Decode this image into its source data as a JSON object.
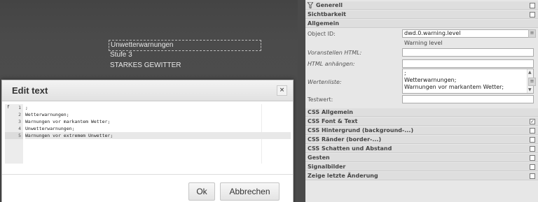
{
  "canvas": {
    "widgets": [
      "Unwetterwarnungen",
      "Stufe 3",
      "STARKES GEWITTER"
    ]
  },
  "dialog": {
    "title": "Edit text",
    "close": "×",
    "fold_marker": "f",
    "lines": [
      ";",
      "Wetterwarnungen;",
      "Warnungen vor markantem Wetter;",
      "Unwetterwarnungen;",
      "Warnungen vor extremem Unwetter;"
    ],
    "line_numbers": [
      "1",
      "2",
      "3",
      "4",
      "5"
    ],
    "active_line": 5,
    "ok_label": "Ok",
    "cancel_label": "Abbrechen"
  },
  "inspector": {
    "generell": "Generell",
    "sichtbarkeit": "Sichtbarkeit",
    "allgemein": "Allgemein",
    "object_id_label": "Object ID:",
    "object_id_value": "dwd.0.warning.level",
    "object_id_hint": "Warning level",
    "voranstellen_label": "Voranstellen HTML:",
    "anhaengen_label": "HTML anhängen:",
    "wertenliste_label": "Wertenliste:",
    "wertenliste_lines": [
      ";",
      "Wetterwarnungen;",
      "Warnungen vor markantem Wetter;"
    ],
    "testwert_label": "Testwert:",
    "groups": [
      {
        "label": "CSS Allgemein",
        "checkbox": false
      },
      {
        "label": "CSS Font & Text",
        "checkbox": true,
        "checked": true
      },
      {
        "label": "CSS Hintergrund (background-...)",
        "checkbox": true,
        "checked": false
      },
      {
        "label": "CSS Ränder (border-...)",
        "checkbox": true,
        "checked": false
      },
      {
        "label": "CSS Schatten und Abstand",
        "checkbox": true,
        "checked": false
      },
      {
        "label": "Gesten",
        "checkbox": true,
        "checked": false
      },
      {
        "label": "Signalbilder",
        "checkbox": true,
        "checked": false
      },
      {
        "label": "Zeige letzte Änderung",
        "checkbox": true,
        "checked": false
      }
    ],
    "check_mark": "✓",
    "button_glyph": "≡"
  }
}
